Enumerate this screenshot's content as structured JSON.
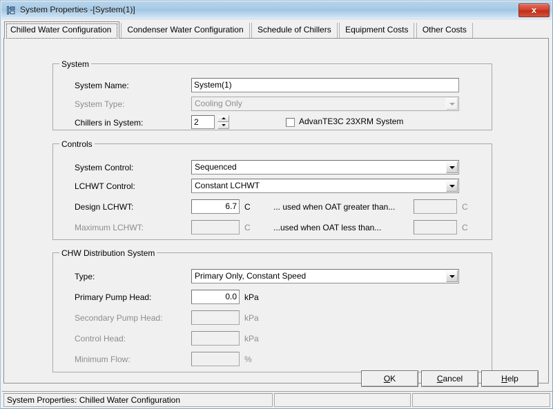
{
  "window": {
    "title": "System Properties -[System(1)]",
    "icon": "application-window-icon",
    "close_label": "x",
    "titlebar_color": "#a8cbe6",
    "close_color": "#d1412c",
    "face_color": "#f0f0f0"
  },
  "tabs": [
    {
      "label": "Chilled Water Configuration",
      "active": true
    },
    {
      "label": "Condenser Water Configuration",
      "active": false
    },
    {
      "label": "Schedule of Chillers",
      "active": false
    },
    {
      "label": "Equipment Costs",
      "active": false
    },
    {
      "label": "Other Costs",
      "active": false
    }
  ],
  "groups": {
    "system": {
      "title": "System",
      "system_name": {
        "label": "System Name:",
        "value": "System(1)"
      },
      "system_type": {
        "label": "System Type:",
        "value": "Cooling Only",
        "disabled": true
      },
      "chillers_in_system": {
        "label": "Chillers in System:",
        "value": "2"
      },
      "advan_checkbox": {
        "label": "AdvanTE3C 23XRM System",
        "checked": false
      }
    },
    "controls": {
      "title": "Controls",
      "system_control": {
        "label": "System Control:",
        "value": "Sequenced"
      },
      "lchwt_control": {
        "label": "LCHWT Control:",
        "value": "Constant LCHWT"
      },
      "design_lchwt": {
        "label": "Design LCHWT:",
        "value": "6.7",
        "unit": "C"
      },
      "maximum_lchwt": {
        "label": "Maximum LCHWT:",
        "value": "",
        "unit": "C",
        "disabled": true
      },
      "oat_greater": {
        "label": "... used when OAT greater than...",
        "value": "",
        "unit": "C",
        "disabled": true
      },
      "oat_less": {
        "label": "...used when OAT less than...",
        "value": "",
        "unit": "C",
        "disabled": true
      }
    },
    "chw": {
      "title": "CHW Distribution System",
      "type": {
        "label": "Type:",
        "value": "Primary Only, Constant Speed"
      },
      "primary_pump_head": {
        "label": "Primary Pump Head:",
        "value": "0.0",
        "unit": "kPa"
      },
      "secondary_pump_head": {
        "label": "Secondary Pump Head:",
        "value": "",
        "unit": "kPa",
        "disabled": true
      },
      "control_head": {
        "label": "Control Head:",
        "value": "",
        "unit": "kPa",
        "disabled": true
      },
      "minimum_flow": {
        "label": "Minimum Flow:",
        "value": "",
        "unit": "%",
        "disabled": true
      }
    }
  },
  "buttons": {
    "ok": {
      "mnemonic": "O",
      "rest": "K"
    },
    "cancel": {
      "mnemonic": "C",
      "rest": "ancel"
    },
    "help": {
      "mnemonic": "H",
      "rest": "elp"
    }
  },
  "statusbar": {
    "panel1": "System Properties:  Chilled Water Configuration",
    "panel2": "",
    "panel3": ""
  }
}
